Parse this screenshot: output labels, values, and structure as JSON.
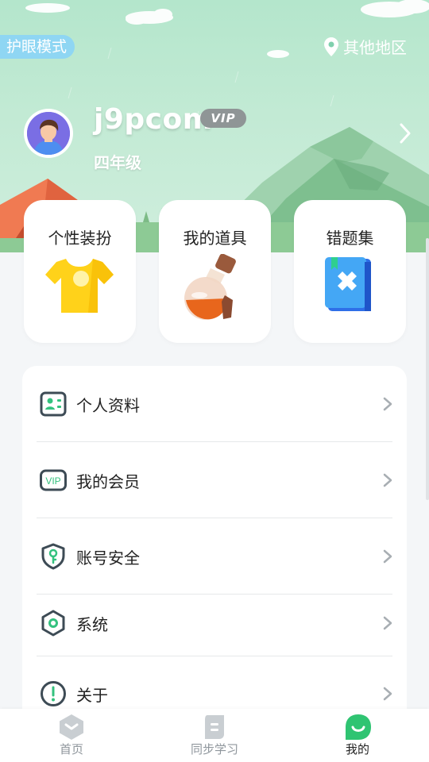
{
  "header": {
    "eye_mode_label": "护眼模式",
    "region_label": "其他地区"
  },
  "profile": {
    "username": "j9pcom",
    "vip_badge": "VIP",
    "grade": "四年级"
  },
  "cards": [
    {
      "label": "个性装扮",
      "icon": "tshirt-icon"
    },
    {
      "label": "我的道具",
      "icon": "potion-icon"
    },
    {
      "label": "错题集",
      "icon": "mistake-book-icon"
    }
  ],
  "menu": [
    {
      "label": "个人资料",
      "icon": "profile-card-icon"
    },
    {
      "label": "我的会员",
      "icon": "vip-icon"
    },
    {
      "label": "账号安全",
      "icon": "shield-key-icon"
    },
    {
      "label": "系统",
      "icon": "hexagon-settings-icon"
    },
    {
      "label": "关于",
      "icon": "info-icon"
    }
  ],
  "menu_icon_vip_text": "VIP",
  "tabbar": [
    {
      "label": "首页",
      "icon": "home-icon"
    },
    {
      "label": "同步学习",
      "icon": "sync-study-icon"
    },
    {
      "label": "我的",
      "icon": "me-icon"
    }
  ],
  "colors": {
    "accent": "#2fc472",
    "icon_stroke": "#3d4b55",
    "icon_green": "#34c27f",
    "tab_inactive": "#c9ced2"
  }
}
